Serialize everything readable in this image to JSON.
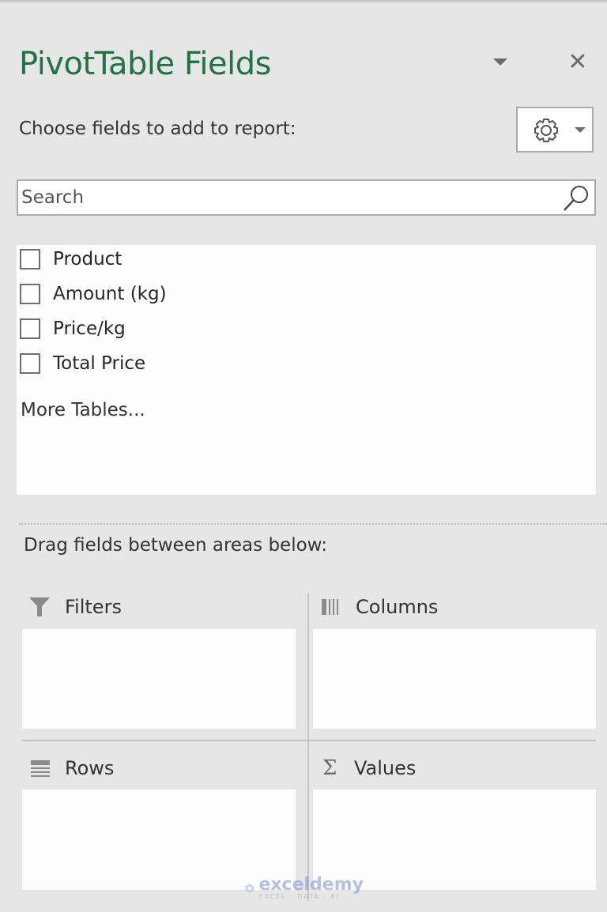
{
  "panel": {
    "title": "PivotTable Fields",
    "title_color": "#217346",
    "close_label": "✕",
    "subtitle": "Choose fields to add to report:"
  },
  "search": {
    "placeholder": "Search",
    "value": ""
  },
  "fields": [
    {
      "label": "Product",
      "checked": false
    },
    {
      "label": "Amount (kg)",
      "checked": false
    },
    {
      "label": "Price/kg",
      "checked": false
    },
    {
      "label": "Total Price",
      "checked": false
    }
  ],
  "more_tables_label": "More Tables...",
  "drag_label": "Drag fields between areas below:",
  "areas": {
    "filters": {
      "label": "Filters",
      "icon": "filter-icon"
    },
    "columns": {
      "label": "Columns",
      "icon": "columns-icon"
    },
    "rows": {
      "label": "Rows",
      "icon": "rows-icon"
    },
    "values": {
      "label": "Values",
      "icon": "sigma-icon",
      "glyph": "Σ"
    }
  },
  "watermark": {
    "brand": "exceldemy",
    "tagline": "EXCEL · DATA · BI"
  }
}
